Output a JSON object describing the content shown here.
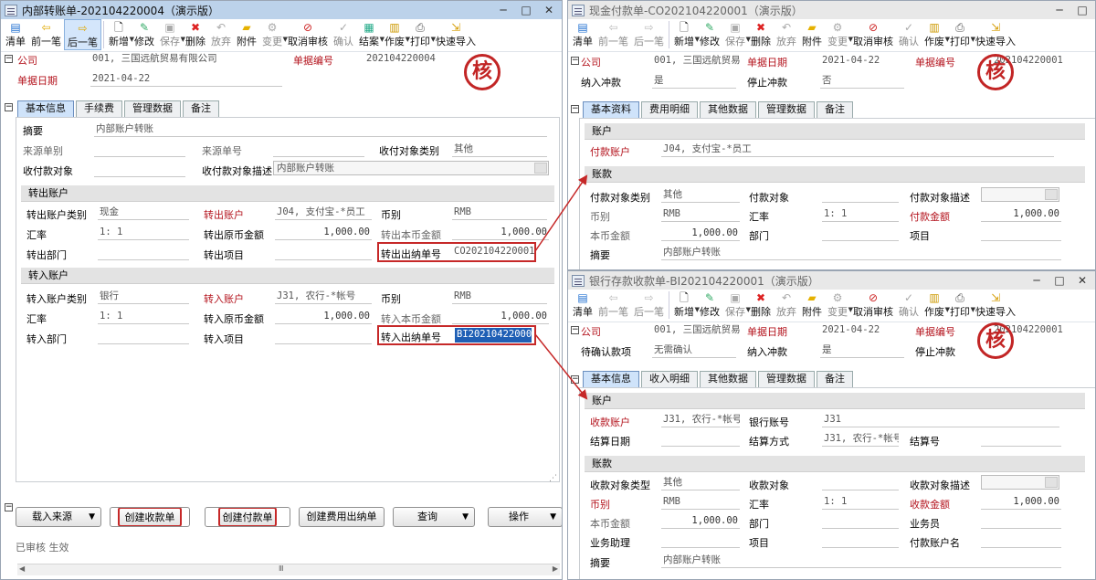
{
  "toolbar_common": {
    "clear": "清单",
    "prev": "前一笔",
    "next": "后一笔",
    "new": "新增",
    "edit": "修改",
    "save": "保存",
    "delete": "删除",
    "discard": "放弃",
    "attach": "附件",
    "change": "变更",
    "unaudit": "取消审核",
    "confirm": "确认",
    "close_case": "结案",
    "void": "作废",
    "print": "打印",
    "quick_import": "快速导入"
  },
  "seal_char": "核",
  "left": {
    "title": "内部转账单-202104220004（演示版）",
    "company_label": "公司",
    "company_value": "001, 三国远航贸易有限公司",
    "doc_no_label": "单据编号",
    "doc_no_value": "202104220004",
    "doc_date_label": "单据日期",
    "doc_date_value": "2021-04-22",
    "tabs": [
      "基本信息",
      "手续费",
      "管理数据",
      "备注"
    ],
    "summary_label": "摘要",
    "summary_value": "内部账户转账",
    "source_type_label": "来源单别",
    "source_no_label": "来源单号",
    "party_type_label": "收付对象类别",
    "party_type_value": "其他",
    "party_label": "收付款对象",
    "party_desc_label": "收付款对象描述",
    "party_desc_value": "内部账户转账",
    "out_section": "转出账户",
    "out_acc_type_label": "转出账户类别",
    "out_acc_type_value": "现金",
    "out_acc_label": "转出账户",
    "out_acc_value": "J04, 支付宝-*员工",
    "out_cur_label": "币别",
    "out_cur_value": "RMB",
    "out_rate_label": "汇率",
    "out_rate_value": "1: 1",
    "out_amt_label": "转出原币金额",
    "out_amt_value": "1,000.00",
    "out_local_label": "转出本币金额",
    "out_local_value": "1,000.00",
    "out_dept_label": "转出部门",
    "out_proj_label": "转出项目",
    "out_cashier_label": "转出出纳单号",
    "out_cashier_value": "CO202104220001",
    "in_section": "转入账户",
    "in_acc_type_label": "转入账户类别",
    "in_acc_type_value": "银行",
    "in_acc_label": "转入账户",
    "in_acc_value": "J31, 农行-*帐号",
    "in_cur_label": "币别",
    "in_cur_value": "RMB",
    "in_rate_label": "汇率",
    "in_rate_value": "1: 1",
    "in_amt_label": "转入原币金额",
    "in_amt_value": "1,000.00",
    "in_local_label": "转入本币金额",
    "in_local_value": "1,000.00",
    "in_dept_label": "转入部门",
    "in_proj_label": "转入项目",
    "in_cashier_label": "转入出纳单号",
    "in_cashier_value": "BI202104220001",
    "buttons": {
      "load_source": "载入来源",
      "create_receipt": "创建收款单",
      "create_payment": "创建付款单",
      "create_fee": "创建费用出纳单",
      "query": "查询",
      "operate": "操作"
    },
    "status": "已审核 生效"
  },
  "right_top": {
    "title": "现金付款单-CO202104220001（演示版）",
    "company_label": "公司",
    "company_value": "001, 三国远航贸易",
    "doc_date_label": "单据日期",
    "doc_date_value": "2021-04-22",
    "doc_no_label": "单据编号",
    "doc_no_value": "202104220001",
    "offset_label": "纳入冲款",
    "offset_value": "是",
    "stop_offset_label": "停止冲款",
    "stop_offset_value": "否",
    "tabs": [
      "基本资料",
      "费用明细",
      "其他数据",
      "管理数据",
      "备注"
    ],
    "acc_section": "账户",
    "pay_acc_label": "付款账户",
    "pay_acc_value": "J04, 支付宝-*员工",
    "fund_section": "账款",
    "party_type_label": "付款对象类别",
    "party_type_value": "其他",
    "party_label": "付款对象",
    "party_desc_label": "付款对象描述",
    "cur_label": "币别",
    "cur_value": "RMB",
    "rate_label": "汇率",
    "rate_value": "1: 1",
    "amt_label": "付款金额",
    "amt_value": "1,000.00",
    "local_label": "本币金额",
    "local_value": "1,000.00",
    "dept_label": "部门",
    "proj_label": "项目",
    "summary_label": "摘要",
    "summary_value": "内部账户转账"
  },
  "right_bottom": {
    "title": "银行存款收款单-BI202104220001（演示版）",
    "company_label": "公司",
    "company_value": "001, 三国远航贸易",
    "doc_date_label": "单据日期",
    "doc_date_value": "2021-04-22",
    "doc_no_label": "单据编号",
    "doc_no_value": "202104220001",
    "pending_label": "待确认款项",
    "pending_value": "无需确认",
    "offset_label": "纳入冲款",
    "offset_value": "是",
    "stop_offset_label": "停止冲款",
    "tabs": [
      "基本信息",
      "收入明细",
      "其他数据",
      "管理数据",
      "备注"
    ],
    "acc_section": "账户",
    "rec_acc_label": "收款账户",
    "rec_acc_value": "J31, 农行-*帐号",
    "bank_no_label": "银行账号",
    "bank_no_value": "J31",
    "settle_date_label": "结算日期",
    "settle_method_label": "结算方式",
    "settle_method_value": "J31, 农行-*帐号",
    "settle_no_label": "结算号",
    "fund_section": "账款",
    "party_type_label": "收款对象类型",
    "party_type_value": "其他",
    "party_label": "收款对象",
    "party_desc_label": "收款对象描述",
    "cur_label": "币别",
    "cur_value": "RMB",
    "rate_label": "汇率",
    "rate_value": "1: 1",
    "amt_label": "收款金额",
    "amt_value": "1,000.00",
    "local_label": "本币金额",
    "local_value": "1,000.00",
    "dept_label": "部门",
    "salesman_label": "业务员",
    "assistant_label": "业务助理",
    "proj_label": "项目",
    "payer_name_label": "付款账户名",
    "summary_label": "摘要",
    "summary_value": "内部账户转账"
  }
}
